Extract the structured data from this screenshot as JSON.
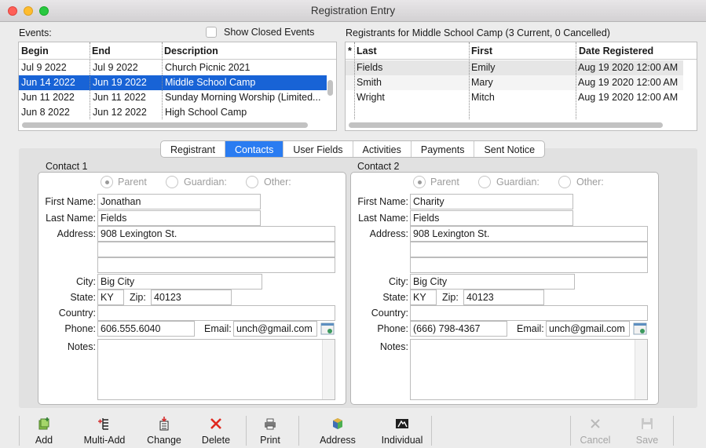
{
  "window": {
    "title": "Registration Entry"
  },
  "events": {
    "label": "Events:",
    "show_closed_label": "Show Closed Events",
    "columns": [
      "Begin",
      "End",
      "Description"
    ],
    "rows": [
      {
        "begin": "Jul 9 2022",
        "end": "Jul 9 2022",
        "description": "Church Picnic 2021"
      },
      {
        "begin": "Jun 14 2022",
        "end": "Jun 19 2022",
        "description": "Middle School Camp"
      },
      {
        "begin": "Jun 11 2022",
        "end": "Jun 11 2022",
        "description": "Sunday Morning Worship (Limited..."
      },
      {
        "begin": "Jun 8 2022",
        "end": "Jun 12 2022",
        "description": "High School Camp"
      }
    ],
    "selected_index": 1
  },
  "registrants": {
    "label": "Registrants for Middle School Camp (3 Current, 0 Cancelled)",
    "columns": [
      "*",
      "Last",
      "First",
      "Date Registered"
    ],
    "rows": [
      {
        "last": "Fields",
        "first": "Emily",
        "date": "Aug 19 2020 12:00 AM"
      },
      {
        "last": "Smith",
        "first": "Mary",
        "date": "Aug 19 2020 12:00 AM"
      },
      {
        "last": "Wright",
        "first": "Mitch",
        "date": "Aug 19 2020 12:00 AM"
      }
    ]
  },
  "tabs": [
    {
      "label": "Registrant",
      "active": false
    },
    {
      "label": "Contacts",
      "active": true
    },
    {
      "label": "User Fields",
      "active": false
    },
    {
      "label": "Activities",
      "active": false
    },
    {
      "label": "Payments",
      "active": false
    },
    {
      "label": "Sent Notice",
      "active": false
    }
  ],
  "field_labels": {
    "first_name": "First Name:",
    "last_name": "Last Name:",
    "address": "Address:",
    "city": "City:",
    "state": "State:",
    "zip": "Zip:",
    "country": "Country:",
    "phone": "Phone:",
    "email": "Email:",
    "notes": "Notes:"
  },
  "relationship_options": [
    "Parent",
    "Guardian:",
    "Other:"
  ],
  "contacts": [
    {
      "title": "Contact 1",
      "relationship": "Parent",
      "first_name": "Jonathan",
      "last_name": "Fields",
      "address1": "908 Lexington St.",
      "address2": "",
      "address3": "",
      "city": "Big City",
      "state": "KY",
      "zip": "40123",
      "country": "",
      "phone": "606.555.6040",
      "email": "unch@gmail.com",
      "notes": ""
    },
    {
      "title": "Contact 2",
      "relationship": "Parent",
      "first_name": "Charity",
      "last_name": "Fields",
      "address1": "908 Lexington St.",
      "address2": "",
      "address3": "",
      "city": "Big City",
      "state": "KY",
      "zip": "40123",
      "country": "",
      "phone": "(666) 798-4367",
      "email": "unch@gmail.com",
      "notes": ""
    }
  ],
  "toolbar": {
    "add": "Add",
    "multi_add": "Multi-Add",
    "change": "Change",
    "delete": "Delete",
    "print": "Print",
    "address": "Address",
    "individual": "Individual",
    "cancel": "Cancel",
    "save": "Save"
  },
  "colors": {
    "selection": "#1863d6",
    "active_tab": "#2a7cf1",
    "delete_icon": "#e0281f",
    "add_icon": "#4caf50"
  }
}
